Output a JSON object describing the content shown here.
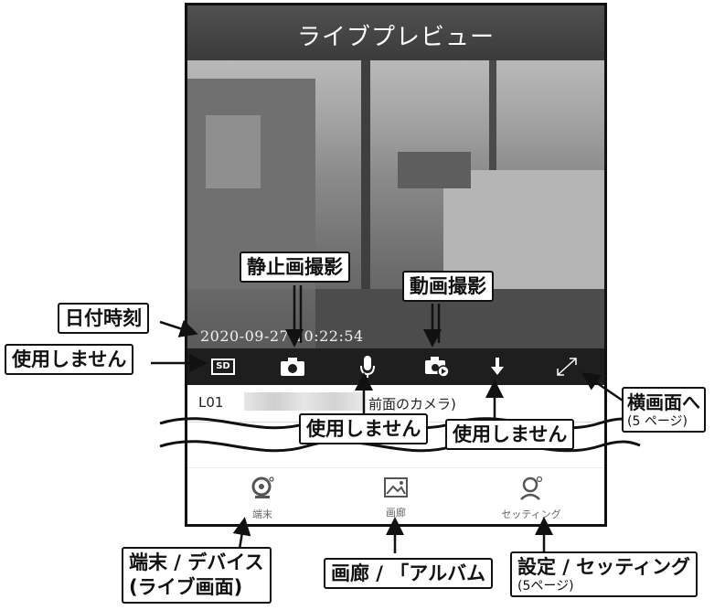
{
  "header": {
    "title": "ライブプレビュー"
  },
  "video": {
    "timestamp": "2020-09-27 10:22:54"
  },
  "controls": {
    "sd_label": "SD",
    "icons": [
      "sd-icon",
      "camera-icon",
      "microphone-icon",
      "video-record-icon",
      "download-icon",
      "fullscreen-icon"
    ]
  },
  "device": {
    "name": "L01",
    "suffix": "前面のカメラ)"
  },
  "tabs": [
    {
      "label": "端末",
      "icon": "device-camera-icon"
    },
    {
      "label": "画廊",
      "icon": "gallery-icon"
    },
    {
      "label": "セッティング",
      "icon": "settings-user-icon"
    }
  ],
  "callouts": {
    "date_time": "日付時刻",
    "not_used_left": "使用しません",
    "still_photo": "静止画撮影",
    "video_record": "動画撮影",
    "not_used_mic": "使用しません",
    "not_used_download": "使用しません",
    "landscape": "横画面へ",
    "landscape_page": "(5 ページ)",
    "device_line1": "端末 / デバイス",
    "device_line2": "(ライブ画面)",
    "gallery": "画廊 / 「アルバム",
    "settings": "設定 / セッティング",
    "settings_page": "(5ページ)"
  }
}
